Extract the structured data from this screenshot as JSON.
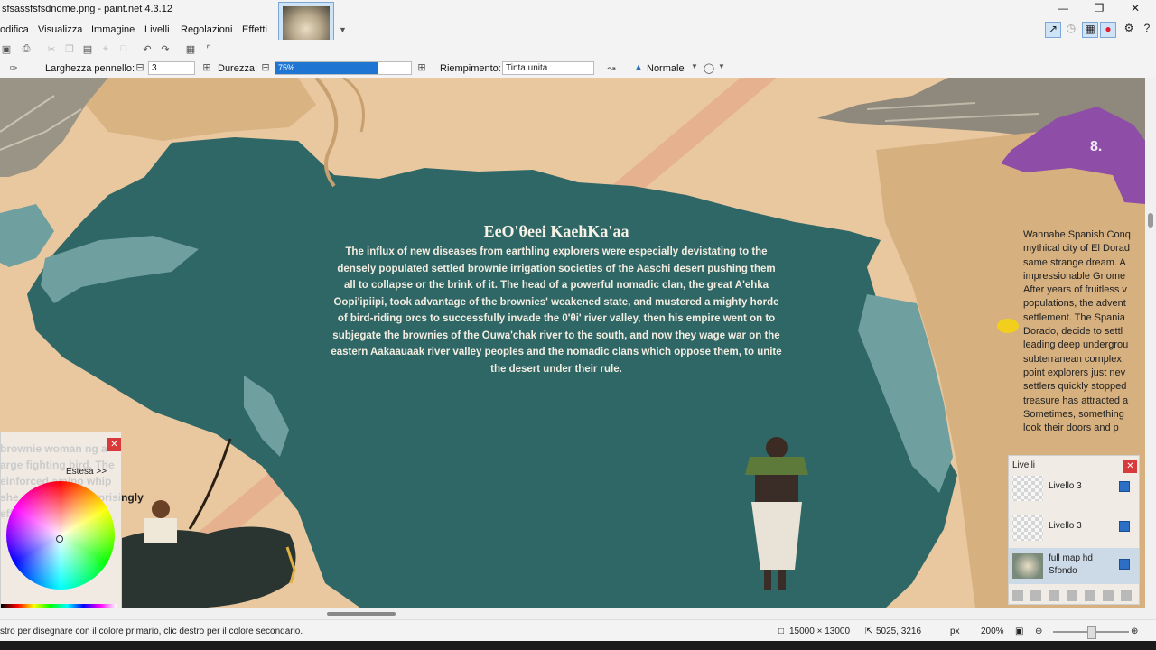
{
  "window": {
    "title": "sfsassfsfsdnome.png - paint.net 4.3.12"
  },
  "menu": {
    "items": [
      "odifica",
      "Visualizza",
      "Immagine",
      "Livelli",
      "Regolazioni",
      "Effetti"
    ]
  },
  "options_bar": {
    "brush_width_label": "Larghezza pennello:",
    "brush_width_value": "3",
    "hardness_label": "Durezza:",
    "hardness_value": "75%",
    "hardness_fraction": 0.75,
    "fill_label": "Riempimento:",
    "fill_value": "Tinta unita",
    "blend_value": "Normale"
  },
  "map": {
    "title": "EeO'θeei KaehKa'aa",
    "body": "The influx of  new diseases from earthling explorers were especially devistating to the densely populated settled brownie irrigation societies of the Aaschi desert pushing them all to collapse or the brink of it. The head of a powerful nomadic clan, the great A'ehka Oopi'ipiipi, took advantage of the brownies' weakened state, and mustered a mighty horde of bird-riding orcs to successfully invade the 0'θi' river valley, then his empire went on to subjegate the brownies of the Ouwa'chak river to the south, and now they wage war on the eastern Aakaauaak river valley peoples and the nomadic clans which oppose them, to unite the desert under their rule.",
    "region_number": "8.",
    "side_text": [
      "Wannabe Spanish Conq",
      "mythical city of El Dorad",
      "same strange dream. A",
      "impressionable Gnome",
      "After years of fruitless v",
      "populations, the advent",
      "settlement. The Spania",
      "Dorado, decide to settl",
      "leading deep undergrou",
      "subterranean complex.",
      "point explorers just nev",
      "settlers quickly stopped",
      "treasure has attracted a",
      "Sometimes, something",
      " look their doors and p"
    ],
    "left_note": [
      "brownie woman   ng a",
      "arge fighting bird. The",
      "einforced   amino   whip",
      "she carries is a surprisingly",
      "effective weapon"
    ]
  },
  "color_panel": {
    "mode_label": "Estesa >>"
  },
  "layers_panel": {
    "title": "Livelli",
    "layers": [
      {
        "name": "Livello 3",
        "visible": true
      },
      {
        "name": "Livello 3",
        "visible": true
      },
      {
        "name": "full map hd",
        "visible": true
      }
    ],
    "background_label": "Sfondo"
  },
  "statusbar": {
    "hint": "stro per disegnare con il colore primario, clic destro per il colore secondario.",
    "image_size": "15000 × 13000",
    "cursor_pos": "5025, 3216",
    "unit": "px",
    "zoom": "200%"
  },
  "colors": {
    "land": "#e9c8a0",
    "desert_sea": "#2f6666",
    "lake": "#6f9f9f",
    "purple_region": "#8e4ea8",
    "accent_blue": "#1f76d2"
  }
}
